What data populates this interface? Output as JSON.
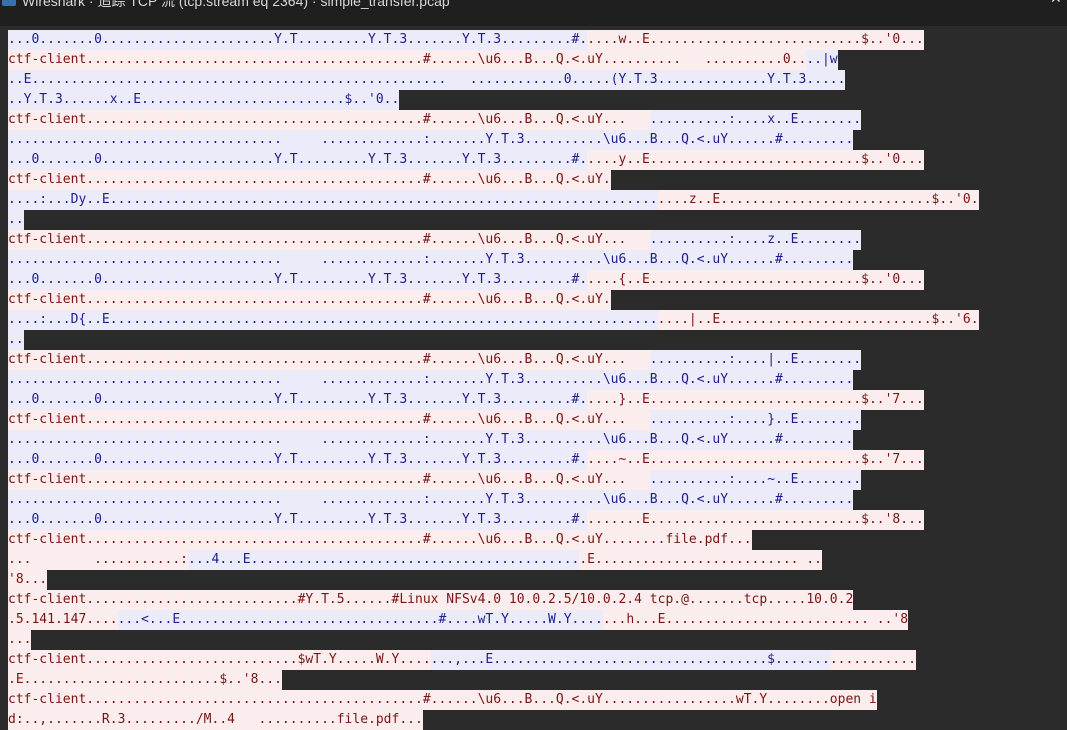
{
  "window": {
    "title": "Wireshark · 追踪 TCP 流 (tcp.stream eq 2364) · simple_transfer.pcap",
    "app_icon": "wireshark-icon",
    "minimize_glyph": "—",
    "close_glyph": "✕"
  },
  "colors": {
    "client_bg": "#fbeded",
    "client_fg": "#7a1414",
    "server_bg": "#ebebfa",
    "server_fg": "#1e1e8c",
    "background": "#2b2b2b"
  },
  "stream_lines": [
    [
      {
        "d": "s",
        "t": "...0.......0......................Y.T.........Y.T.3.......Y.T.3.........#."
      },
      {
        "d": "c",
        "t": "....w..E...........................$..'0..."
      }
    ],
    [
      {
        "d": "c",
        "t": "ctf-client...........................................#......\\u6...B...Q.<.uY..........   ..........0.."
      },
      {
        "d": "s",
        "t": "..|w"
      }
    ],
    [
      {
        "d": "s",
        "t": "..E.....................................................   ............0.....(Y.T.3..............Y.T.3....."
      }
    ],
    [
      {
        "d": "s",
        "t": "..Y.T.3......x..E..........................$..'0.."
      }
    ],
    [
      {
        "d": "c",
        "t": "ctf-client...........................................#......\\u6...B...Q.<.uY...   "
      },
      {
        "d": "s",
        "t": "..........:....x..E........"
      }
    ],
    [
      {
        "d": "s",
        "t": "...................................     .............:.......Y.T.3..........\\u6...B...Q.<.uY......#........."
      }
    ],
    [
      {
        "d": "s",
        "t": "...0.......0......................Y.T.........Y.T.3.......Y.T.3.........#."
      },
      {
        "d": "c",
        "t": "....y..E...........................$..'0..."
      }
    ],
    [
      {
        "d": "c",
        "t": "ctf-client...........................................#......\\u6...B...Q.<.uY."
      }
    ],
    [
      {
        "d": "s",
        "t": "....:...Dy..E......................................................................"
      },
      {
        "d": "c",
        "t": "....z..E...........................$..'0."
      }
    ],
    [
      {
        "d": "s",
        "t": ".."
      }
    ],
    [
      {
        "d": "c",
        "t": "ctf-client...........................................#......\\u6...B...Q.<.uY...   "
      },
      {
        "d": "s",
        "t": "..........:....z..E........"
      }
    ],
    [
      {
        "d": "s",
        "t": "...................................     .............:.......Y.T.3..........\\u6...B...Q.<.uY......#........."
      }
    ],
    [
      {
        "d": "s",
        "t": "...0.......0......................Y.T.........Y.T.3.......Y.T.3.........#."
      },
      {
        "d": "c",
        "t": "....{..E...........................$..'0..."
      }
    ],
    [
      {
        "d": "c",
        "t": "ctf-client...........................................#......\\u6...B...Q.<.uY."
      }
    ],
    [
      {
        "d": "s",
        "t": "....:...D{..E......................................................................"
      },
      {
        "d": "c",
        "t": "....|..E...........................$..'6."
      }
    ],
    [
      {
        "d": "s",
        "t": ".."
      }
    ],
    [
      {
        "d": "c",
        "t": "ctf-client...........................................#......\\u6...B...Q.<.uY...   "
      },
      {
        "d": "s",
        "t": "..........:....|..E........"
      }
    ],
    [
      {
        "d": "s",
        "t": "...................................     .............:.......Y.T.3..........\\u6...B...Q.<.uY......#........."
      }
    ],
    [
      {
        "d": "s",
        "t": "...0.......0......................Y.T.........Y.T.3.......Y.T.3.........#."
      },
      {
        "d": "c",
        "t": "....}..E...........................$..'7..."
      }
    ],
    [
      {
        "d": "c",
        "t": "ctf-client...........................................#......\\u6...B...Q.<.uY...   "
      },
      {
        "d": "s",
        "t": "..........:....}..E........"
      }
    ],
    [
      {
        "d": "s",
        "t": "...................................     .............:.......Y.T.3..........\\u6...B...Q.<.uY......#........."
      }
    ],
    [
      {
        "d": "s",
        "t": "...0.......0......................Y.T.........Y.T.3.......Y.T.3.........#."
      },
      {
        "d": "c",
        "t": "....~..E...........................$..'7..."
      }
    ],
    [
      {
        "d": "c",
        "t": "ctf-client...........................................#......\\u6...B...Q.<.uY...   "
      },
      {
        "d": "s",
        "t": "..........:....~..E........"
      }
    ],
    [
      {
        "d": "s",
        "t": "...................................     .............:.......Y.T.3..........\\u6...B...Q.<.uY......#........."
      }
    ],
    [
      {
        "d": "s",
        "t": "...0.......0......................Y.T.........Y.T.3.......Y.T.3.........#."
      },
      {
        "d": "c",
        "t": ".......E...........................$..'8..."
      }
    ],
    [
      {
        "d": "c",
        "t": "ctf-client...........................................#......\\u6...B...Q.<.uY........file.pdf..."
      }
    ],
    [
      {
        "d": "c",
        "t": "...        ...........:"
      },
      {
        "d": "s",
        "t": "...4...E.........................................."
      },
      {
        "d": "c",
        "t": ".E.......................... .."
      }
    ],
    [
      {
        "d": "c",
        "t": "'8..."
      }
    ],
    [
      {
        "d": "c",
        "t": "ctf-client...........................#Y.T.5......#Linux NFSv4.0 10.0.2.5/10.0.2.4 tcp.@.......tcp.....10.0.2"
      }
    ],
    [
      {
        "d": "c",
        "t": ".5.141.147...."
      },
      {
        "d": "s",
        "t": "...<...E.................................#....wT.Y.....W.Y...."
      },
      {
        "d": "c",
        "t": "...h...E.......................... ..'8"
      }
    ],
    [
      {
        "d": "c",
        "t": "..."
      }
    ],
    [
      {
        "d": "c",
        "t": "ctf-client...........................$wT.Y.....W.Y...."
      },
      {
        "d": "s",
        "t": "...,...E...................................$......."
      },
      {
        "d": "c",
        "t": "..........."
      }
    ],
    [
      {
        "d": "c",
        "t": ".E.........................$..'8..."
      }
    ],
    [
      {
        "d": "c",
        "t": "ctf-client...........................................#......\\u6...B...Q.<.uY.................wT.Y........open i"
      }
    ],
    [
      {
        "d": "c",
        "t": "d:..,.......R.3........./M..4   ..........file.pdf..."
      }
    ]
  ]
}
